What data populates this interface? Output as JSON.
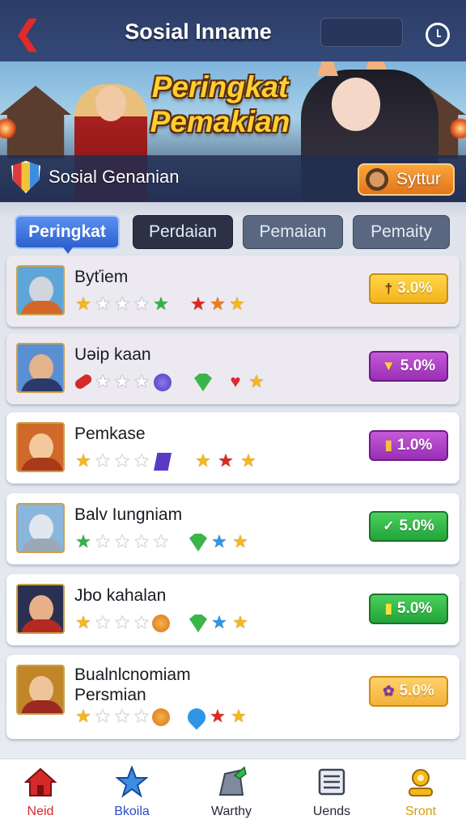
{
  "header": {
    "title": "Sosial Inname",
    "back_icon": "back-arrow-icon",
    "clock_icon": "clock-icon"
  },
  "banner": {
    "title_line1": "Peringkat",
    "title_line2": "Pemakian",
    "subtitle": "Sosial Genanian",
    "action_label": "Syttur"
  },
  "tabs": [
    {
      "label": "Peringkat",
      "active": true
    },
    {
      "label": "Perdaian",
      "active": false
    },
    {
      "label": "Pemaian",
      "active": false
    },
    {
      "label": "Pemaity",
      "active": false
    }
  ],
  "rows": [
    {
      "name": "Byťiem",
      "badge": "3.0%",
      "badge_color": "yellow"
    },
    {
      "name": "Uəip kaan",
      "badge": "5.0%",
      "badge_color": "purple"
    },
    {
      "name": "Pemkase",
      "badge": "1.0%",
      "badge_color": "purple"
    },
    {
      "name": "Balv Iungniam",
      "badge": "5.0%",
      "badge_color": "green"
    },
    {
      "name": "Jbo kahalan",
      "badge": "5.0%",
      "badge_color": "green"
    },
    {
      "name": "Bualnlcnomiam",
      "name_line2": "Persmian",
      "badge": "5.0%",
      "badge_color": "orange"
    }
  ],
  "nav": [
    {
      "label": "Neid",
      "icon": "home-icon",
      "color": "#d42a2a"
    },
    {
      "label": "Bkoila",
      "icon": "star-icon",
      "color": "#2a4cc4"
    },
    {
      "label": "Warthy",
      "icon": "trophy-icon",
      "color": "#23283a"
    },
    {
      "label": "Uends",
      "icon": "list-icon",
      "color": "#23283a"
    },
    {
      "label": "Sront",
      "icon": "profile-icon",
      "color": "#d99a12"
    }
  ]
}
